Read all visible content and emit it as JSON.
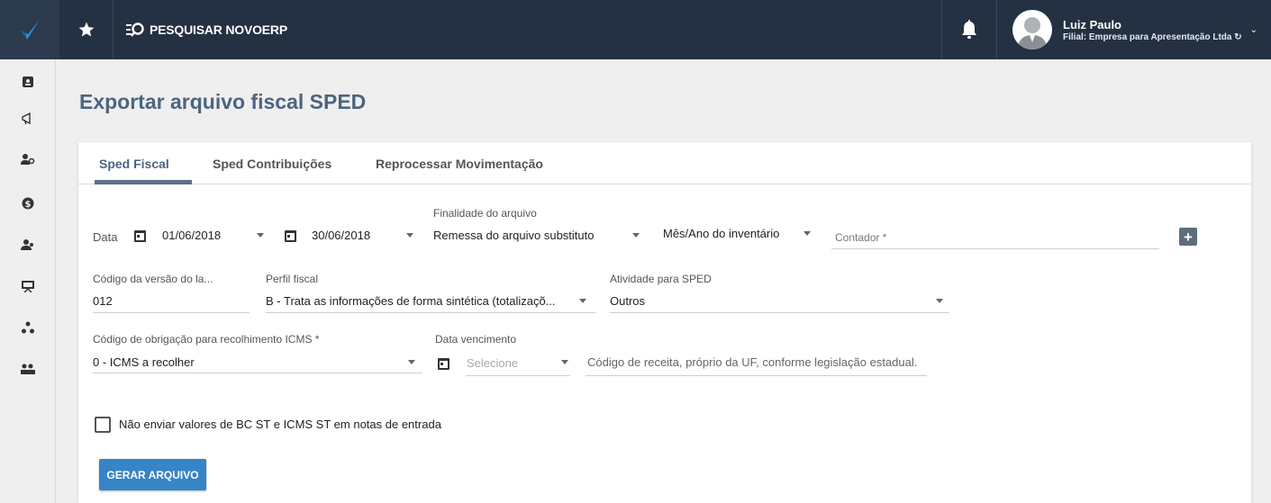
{
  "topbar": {
    "search_label": "PESQUISAR NOVOERP",
    "user_name": "Luiz Paulo",
    "user_filial": "Filial: Empresa para Apresentação Ltda"
  },
  "colors": {
    "topbar": "#243142",
    "accent": "#3685c7",
    "title": "#4c6580"
  },
  "sidebar": {
    "icons": [
      "contacts-icon",
      "megaphone-icon",
      "users-gear-icon",
      "dollar-icon",
      "team-icon",
      "presentation-icon",
      "network-icon",
      "people-card-icon"
    ]
  },
  "page": {
    "title": "Exportar arquivo fiscal SPED"
  },
  "tabs": [
    {
      "label": "Sped Fiscal",
      "active": true
    },
    {
      "label": "Sped Contribuições",
      "active": false
    },
    {
      "label": "Reprocessar Movimentação",
      "active": false
    }
  ],
  "form": {
    "data_label": "Data",
    "date_start": "01/06/2018",
    "date_end": "30/06/2018",
    "finalidade_label": "Finalidade do arquivo",
    "finalidade_value": "Remessa do arquivo substituto",
    "inventario_value": "Mês/Ano do inventário",
    "contador_placeholder": "Contador *",
    "codigo_versao_label": "Código da versão do la...",
    "codigo_versao_value": "012",
    "perfil_label": "Perfil fiscal",
    "perfil_value": "B - Trata as informações de forma sintética (totalizaçõ...",
    "atividade_label": "Atividade para SPED",
    "atividade_value": "Outros",
    "obrigacao_label": "Código de obrigação para recolhimento ICMS *",
    "obrigacao_value": "0 - ICMS a recolher",
    "vencimento_label": "Data vencimento",
    "vencimento_placeholder": "Selecione",
    "receita_placeholder": "Código de receita, próprio da UF, conforme legislação estadual.",
    "checkbox_label": "Não enviar valores de BC ST e ICMS ST em notas de entrada",
    "generate_button": "GERAR ARQUIVO"
  }
}
